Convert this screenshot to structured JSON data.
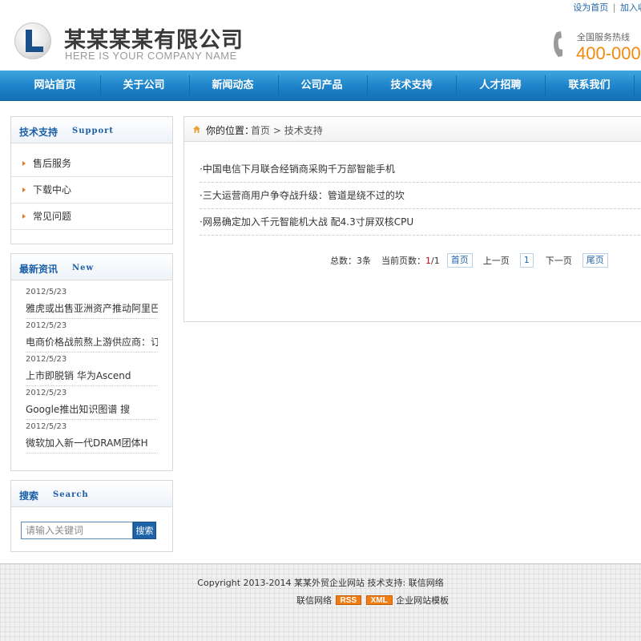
{
  "top_links": {
    "set_home": "设为首页",
    "separator": "|",
    "bookmark": "加入收藏"
  },
  "header": {
    "company_name": "某某某某有限公司",
    "company_tagline": "HERE IS YOUR COMPANY NAME",
    "hotline_label": "全国服务热线",
    "hotline_number": "400-000"
  },
  "nav": {
    "items": [
      {
        "label": "网站首页"
      },
      {
        "label": "关于公司"
      },
      {
        "label": "新闻动态"
      },
      {
        "label": "公司产品"
      },
      {
        "label": "技术支持"
      },
      {
        "label": "人才招聘"
      },
      {
        "label": "联系我们"
      }
    ]
  },
  "sidebar": {
    "support": {
      "title_cn": "技术支持",
      "title_en": "Support",
      "items": [
        {
          "label": "售后服务"
        },
        {
          "label": "下载中心"
        },
        {
          "label": "常见问题"
        }
      ]
    },
    "news": {
      "title_cn": "最新资讯",
      "title_en": "New",
      "items": [
        {
          "date": "2012/5/23",
          "title": "雅虎或出售亚洲资产推动阿里巴"
        },
        {
          "date": "2012/5/23",
          "title": "电商价格战煎熬上游供应商：订"
        },
        {
          "date": "2012/5/23",
          "title": "上市即脱销 华为Ascend"
        },
        {
          "date": "2012/5/23",
          "title": "Google推出知识图谱 搜"
        },
        {
          "date": "2012/5/23",
          "title": "微软加入新一代DRAM团体H"
        }
      ]
    },
    "search": {
      "title_cn": "搜索",
      "title_en": "Search",
      "placeholder": "请输入关键词",
      "button_label": "搜索"
    }
  },
  "main": {
    "breadcrumb": {
      "label": "你的位置：",
      "home": "首页",
      "separator": " > ",
      "current": "技术支持"
    },
    "articles": [
      {
        "title": "·中国电信下月联合经销商采购千万部智能手机"
      },
      {
        "title": "·三大运营商用户争夺战升级：管道是绕不过的坎"
      },
      {
        "title": "·网易确定加入千元智能机大战 配4.3寸屏双核CPU"
      }
    ],
    "pager": {
      "total_label": "总数：",
      "total_value": "3条",
      "current_label": "当前页数：",
      "current_page": "1",
      "total_pages": "/1",
      "first": "首页",
      "prev": "上一页",
      "page_number": "1",
      "next": "下一页",
      "last": "尾页"
    }
  },
  "footer": {
    "copyright": "Copyright 2013-2014 某某外贸企业网站 技术支持: 联信网络",
    "prefix": "联信网络",
    "rss_badge": "RSS",
    "xml_badge": "XML",
    "suffix": "企业网站模板"
  },
  "colors": {
    "nav_blue": "#1d82c8",
    "link_blue": "#2266aa",
    "hotline_orange": "#f08a10",
    "arrow_orange": "#e07b2a",
    "current_page_red": "#cc0000",
    "badge_orange": "#f07c14"
  },
  "icons": {
    "logo": "logo-l-circle",
    "hotline": "phone-icon",
    "breadcrumb": "home-icon",
    "side_item": "arrow-right-icon"
  }
}
